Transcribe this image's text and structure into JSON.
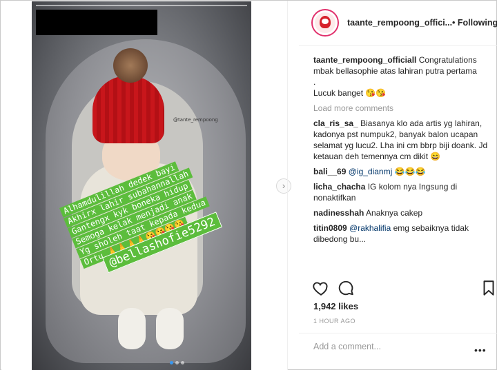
{
  "post": {
    "image_alt": "Baby in red knit hat in a baby bouncer",
    "watermark": "@tante_rempoong",
    "sticker_lines": [
      "Alhamdulillah dedek bayi",
      "Akhirx lahir subahannallah",
      "Gantengx kyk boneka hidup",
      "Semoga kelak menjadi anak",
      "Yg sholeh taat kepada kedua",
      "Ortu 🙏🙏🙏🙏😘😘😘😘"
    ],
    "sticker_handle": "@bellashofie5292",
    "carousel_count": 3,
    "carousel_active": 0
  },
  "header": {
    "username": "taante_rempoong_offici...",
    "follow_label": "• Following"
  },
  "comments": {
    "caption_user": "taante_rempoong_officiall",
    "caption_text": "Congratulations mbak bellasophie atas lahiran putra pertama",
    "caption_dot": ".",
    "caption_extra": "Lucuk banget 😘😘",
    "load_more": "Load more comments",
    "items": [
      {
        "user": "cla_ris_sa_",
        "text": "Biasanya klo ada artis yg lahiran, kadonya pst numpuk2, banyak balon ucapan selamat yg lucu2. Lha ini cm bbrp biji doank. Jd ketauan deh temennya cm dikit 😄",
        "mention": ""
      },
      {
        "user": "bali__69",
        "text": " 😂😂😂",
        "mention": "@ig_dianmj"
      },
      {
        "user": "licha_chacha",
        "text": "IG kolom nya Ingsung di nonaktifkan",
        "mention": ""
      },
      {
        "user": "nadinesshah",
        "text": "Anaknya cakep",
        "mention": ""
      },
      {
        "user": "titin0809",
        "text": " emg sebaiknya tidak dibedong bu...",
        "mention": "@rakhalifia"
      }
    ]
  },
  "stats": {
    "likes": "1,942 likes",
    "time": "1 HOUR AGO"
  },
  "add_comment": {
    "placeholder": "Add a comment...",
    "more": "•••"
  },
  "colors": {
    "sticker_green": "#5cbd3c",
    "hat_red": "#c8161b",
    "mention_blue": "#003569",
    "active_dot": "#3897f0"
  }
}
